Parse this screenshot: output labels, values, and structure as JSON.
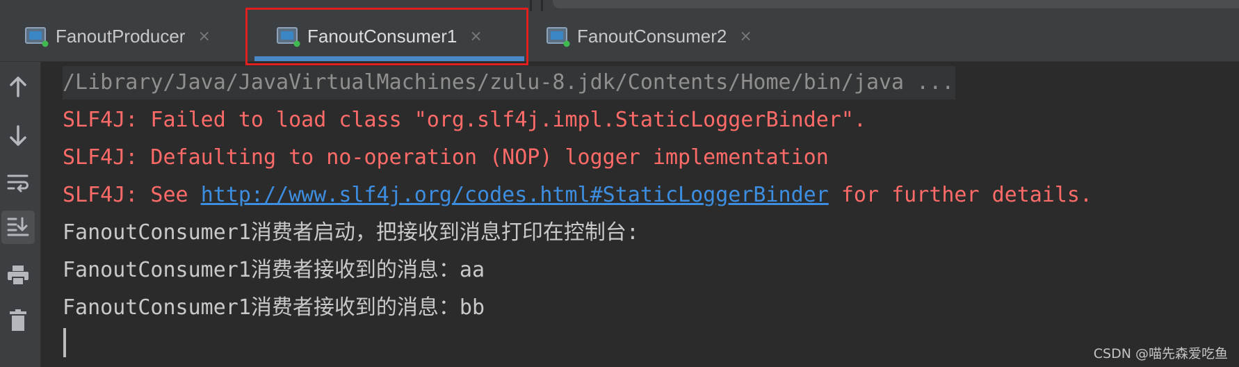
{
  "tabs": [
    {
      "label": "FanoutProducer",
      "close": "×",
      "icon": "run-config-icon",
      "status_color": "#3fb950"
    },
    {
      "label": "FanoutConsumer1",
      "close": "×",
      "icon": "run-config-icon",
      "status_color": "#3fb950",
      "active": true
    },
    {
      "label": "FanoutConsumer2",
      "close": "×",
      "icon": "run-config-icon",
      "status_color": "#3fb950"
    }
  ],
  "toolbar": [
    {
      "icon": "arrow-up-icon"
    },
    {
      "icon": "arrow-down-icon"
    },
    {
      "icon": "soft-wrap-icon"
    },
    {
      "icon": "scroll-to-end-icon",
      "pressed": true
    },
    {
      "icon": "print-icon"
    },
    {
      "icon": "trash-icon"
    }
  ],
  "console": {
    "command": "/Library/Java/JavaVirtualMachines/zulu-8.jdk/Contents/Home/bin/java ...",
    "error1": "SLF4J: Failed to load class \"org.slf4j.impl.StaticLoggerBinder\".",
    "error2": "SLF4J: Defaulting to no-operation (NOP) logger implementation",
    "error3_prefix": "SLF4J: See ",
    "error3_link": "http://www.slf4j.org/codes.html#StaticLoggerBinder",
    "error3_suffix": " for further details.",
    "line4": "FanoutConsumer1消费者启动，把接收到消息打印在控制台:",
    "line5": "FanoutConsumer1消费者接收到的消息：aa",
    "line6": "FanoutConsumer1消费者接收到的消息：bb"
  },
  "watermark": "CSDN @喵先森爱吃鱼",
  "colors": {
    "background": "#2b2b2b",
    "error": "#ff6b68",
    "link": "#3d8ee0",
    "active_tab_underline": "#4a88c7",
    "highlight_box": "#e0201e"
  }
}
